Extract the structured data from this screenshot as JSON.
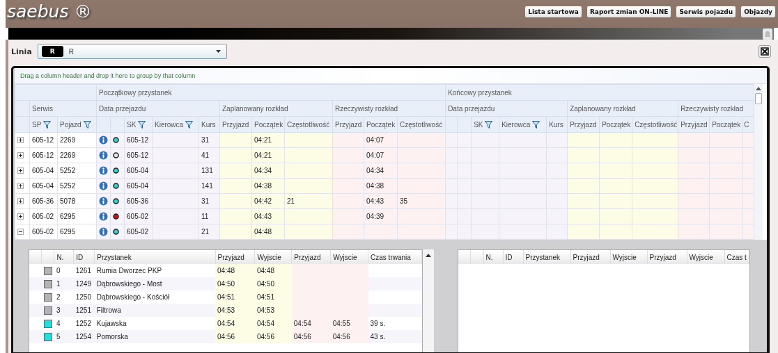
{
  "app": {
    "logo": "saebus ®",
    "nav_buttons": [
      "Lista startowa",
      "Raport zmian ON-LINE",
      "Serwis pojazdu",
      "Objazdy"
    ]
  },
  "line_selector": {
    "label": "Linia",
    "badge": "R",
    "value": "R"
  },
  "grid": {
    "group_hint": "Drag a column header and drop it here to group by that column",
    "header_bands": [
      [
        "Początkowy przystanek",
        "Końcowy przystanek"
      ],
      [
        "Serwis",
        "Data przejazdu",
        "Zaplanowany rozkład",
        "Rzeczywisty rozkład",
        "Data przejazdu",
        "Zaplanowany rozkład",
        "Rzeczywisty rozkład"
      ]
    ],
    "columns": [
      {
        "label": "SP",
        "filter": true
      },
      {
        "label": "Pojazd",
        "filter": true
      },
      {},
      {},
      {
        "label": "SK",
        "filter": true
      },
      {
        "label": "Kierowca",
        "filter": true
      },
      {
        "label": "Kurs"
      },
      {
        "label": "Przyjazd"
      },
      {
        "label": "Początek"
      },
      {
        "label": "Częstotliwość"
      },
      {
        "label": "Przyjazd"
      },
      {
        "label": "Początek"
      },
      {
        "label": "Częstotliwość"
      },
      {},
      {},
      {
        "label": "SK",
        "filter": true
      },
      {
        "label": "Kierowca",
        "filter": true
      },
      {
        "label": "Kurs"
      },
      {
        "label": "Przyjazd"
      },
      {
        "label": "Początek"
      },
      {
        "label": "Częstotliwość"
      },
      {
        "label": "Przyjazd"
      },
      {
        "label": "Początek"
      },
      {
        "label": "C"
      }
    ],
    "rows": [
      {
        "expanded": false,
        "color": "#35d0d0",
        "sp": "605-12",
        "vehicle": "2269",
        "sk": "605-12",
        "course": "31",
        "plan_start": "04:21",
        "real_start": "04:07"
      },
      {
        "expanded": false,
        "color": "#e4e4e4",
        "sp": "605-12",
        "vehicle": "2269",
        "sk": "605-12",
        "course": "41",
        "plan_start": "04:21",
        "real_start": "04:07"
      },
      {
        "expanded": false,
        "color": "#35d0d0",
        "sp": "605-04",
        "vehicle": "5252",
        "sk": "605-04",
        "course": "131",
        "plan_start": "04:34",
        "real_start": "04:34"
      },
      {
        "expanded": false,
        "color": "#35d0d0",
        "sp": "605-04",
        "vehicle": "5252",
        "sk": "605-04",
        "course": "141",
        "plan_start": "04:38",
        "real_start": "04:38"
      },
      {
        "expanded": false,
        "color": "#35d0d0",
        "sp": "605-36",
        "vehicle": "5078",
        "sk": "605-36",
        "course": "31",
        "plan_start": "04:42",
        "plan_freq": "21",
        "real_start": "04:43",
        "real_freq": "35"
      },
      {
        "expanded": false,
        "color": "#c41a1a",
        "sp": "605-02",
        "vehicle": "6295",
        "sk": "605-02",
        "course": "11",
        "plan_start": "04:43",
        "real_start": "04:39"
      },
      {
        "expanded": true,
        "color": "#35d0d0",
        "sp": "605-02",
        "vehicle": "6295",
        "sk": "605-02",
        "course": "21",
        "plan_start": "04:48"
      }
    ]
  },
  "stops_left": {
    "columns": [
      "N.",
      "ID",
      "Przystanek",
      "Przyjazd",
      "Wyjscie",
      "Przyjazd",
      "Wyjscie",
      "Czas trwania"
    ],
    "rows": [
      {
        "color": "#b4b4b4",
        "n": "0",
        "id": "1261",
        "name": "Rumia Dworzec PKP",
        "plan_arrival": "04:48",
        "plan_departure": "04:48"
      },
      {
        "color": "#b4b4b4",
        "n": "1",
        "id": "1249",
        "name": "Dąbrowskiego - Most",
        "plan_arrival": "04:50",
        "plan_departure": "04:50"
      },
      {
        "color": "#b4b4b4",
        "n": "2",
        "id": "1250",
        "name": "Dąbrowskiego - Kościół",
        "plan_arrival": "04:51",
        "plan_departure": "04:51"
      },
      {
        "color": "#b4b4b4",
        "n": "3",
        "id": "1251",
        "name": "Filtrowa",
        "plan_arrival": "04:53",
        "plan_departure": "04:53"
      },
      {
        "color": "#22e0e0",
        "n": "4",
        "id": "1252",
        "name": "Kujawska",
        "plan_arrival": "04:54",
        "plan_departure": "04:54",
        "real_arrival": "04:54",
        "real_departure": "04:55",
        "duration": "39 s."
      },
      {
        "color": "#22e0e0",
        "n": "5",
        "id": "1254",
        "name": "Pomorska",
        "plan_arrival": "04:56",
        "plan_departure": "04:56",
        "real_arrival": "04:56",
        "real_departure": "04:56",
        "duration": "43 s."
      }
    ]
  },
  "stops_right": {
    "columns": [
      "N.",
      "ID",
      "Przystanek",
      "Przyjazd",
      "Wyjscie",
      "Przyjazd",
      "Wyjscie",
      "Czas t"
    ]
  }
}
